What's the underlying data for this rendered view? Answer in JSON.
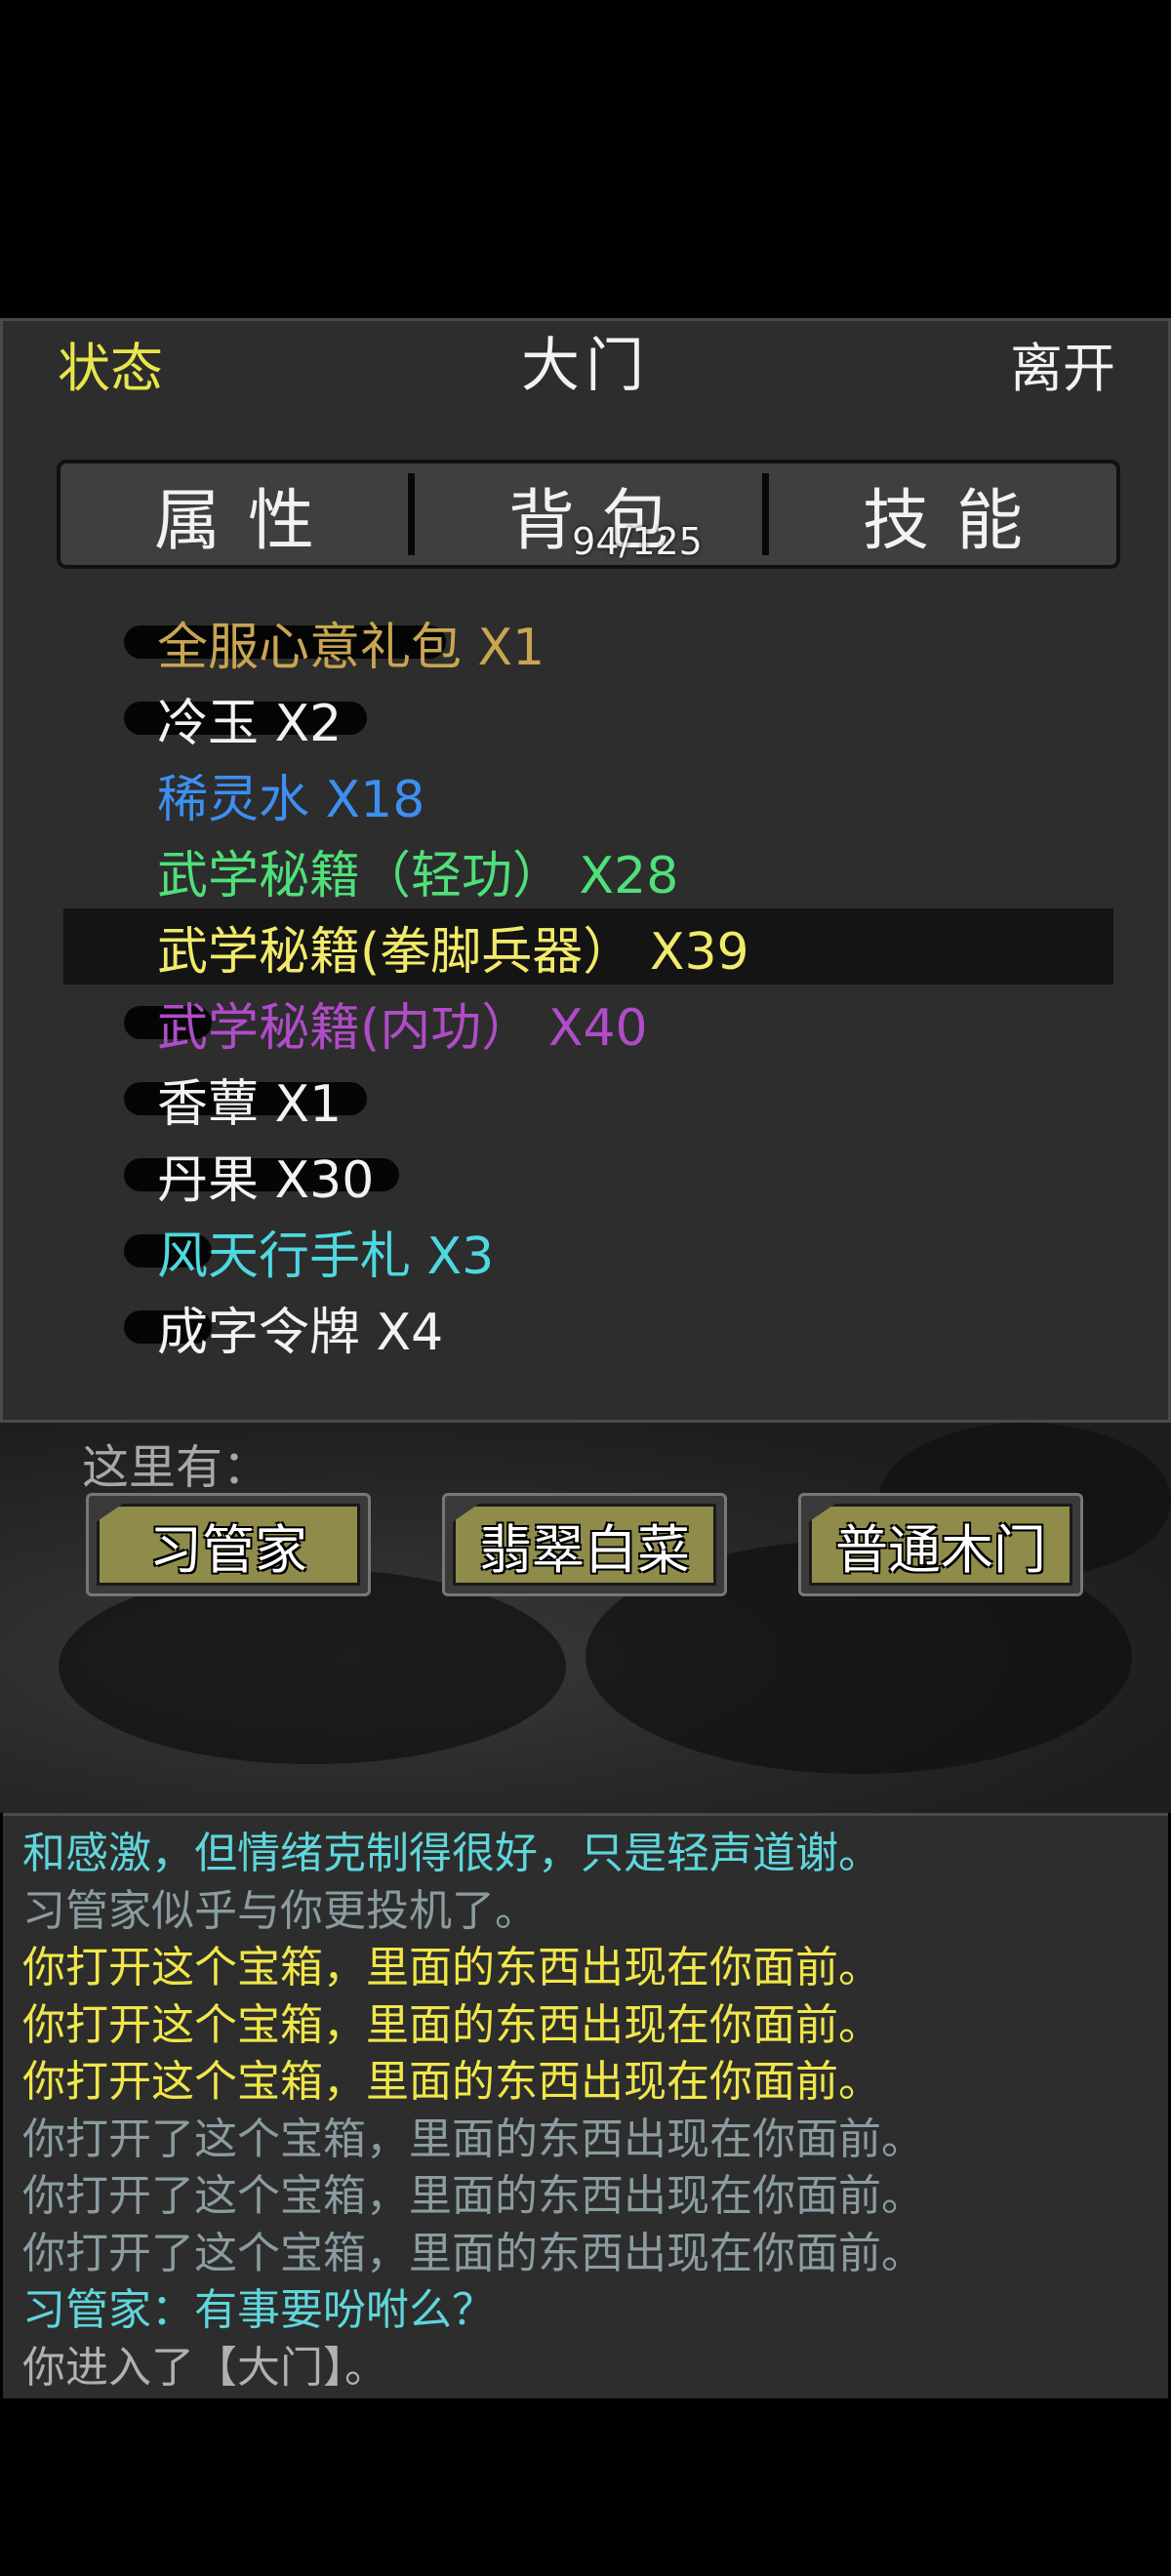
{
  "header": {
    "left_label": "状态",
    "title": "大门",
    "right_label": "离开"
  },
  "tabs": [
    {
      "label": "属性"
    },
    {
      "label": "背包",
      "count": "94/125"
    },
    {
      "label": "技能"
    }
  ],
  "inventory": [
    {
      "name": "全服心意礼包 X1",
      "color": "#c8a552",
      "brush_width": 250
    },
    {
      "name": "冷玉 X2",
      "color": "#f2f2f2",
      "brush_width": 290
    },
    {
      "name": "稀灵水 X18",
      "color": "#3d8ff0",
      "brush_width": 0
    },
    {
      "name": "武学秘籍（轻功） X28",
      "color": "#4fe07a",
      "brush_width": 0
    },
    {
      "name": "武学秘籍(拳脚兵器） X39",
      "color": "#f2ea6a",
      "brush_width": 0,
      "selected": true
    },
    {
      "name": "武学秘籍(内功） X40",
      "color": "#b04cc8",
      "brush_width": 120
    },
    {
      "name": "香蕈 X1",
      "color": "#f2f2f2",
      "brush_width": 290
    },
    {
      "name": "丹果 X30",
      "color": "#f2f2f2",
      "brush_width": 290
    },
    {
      "name": "风天行手札 X3",
      "color": "#4fd8e0",
      "brush_width": 90
    },
    {
      "name": "成字令牌 X4",
      "color": "#f2f2f2",
      "brush_width": 90
    }
  ],
  "here": {
    "label": "这里有：",
    "npcs": [
      "习管家",
      "翡翠白菜",
      "普通木门"
    ]
  },
  "log": [
    {
      "text": "和感激，但情绪克制得很好，只是轻声道谢。",
      "color": "#5fd6dc"
    },
    {
      "text": "习管家似乎与你更投机了。",
      "color": "#8a9ca0"
    },
    {
      "text": "你打开这个宝箱，里面的东西出现在你面前。",
      "color": "#f0e64a"
    },
    {
      "text": "你打开这个宝箱，里面的东西出现在你面前。",
      "color": "#f0e64a"
    },
    {
      "text": "你打开这个宝箱，里面的东西出现在你面前。",
      "color": "#f0e64a"
    },
    {
      "text": "你打开了这个宝箱，里面的东西出现在你面前。",
      "color": "#8a9ca0"
    },
    {
      "text": "你打开了这个宝箱，里面的东西出现在你面前。",
      "color": "#8a9ca0"
    },
    {
      "text": "你打开了这个宝箱，里面的东西出现在你面前。",
      "color": "#8a9ca0"
    },
    {
      "text": "习管家：有事要吩咐么？",
      "color": "#5fd6dc"
    },
    {
      "text": "你进入了【大门】。",
      "color": "#b0b0b0"
    }
  ]
}
